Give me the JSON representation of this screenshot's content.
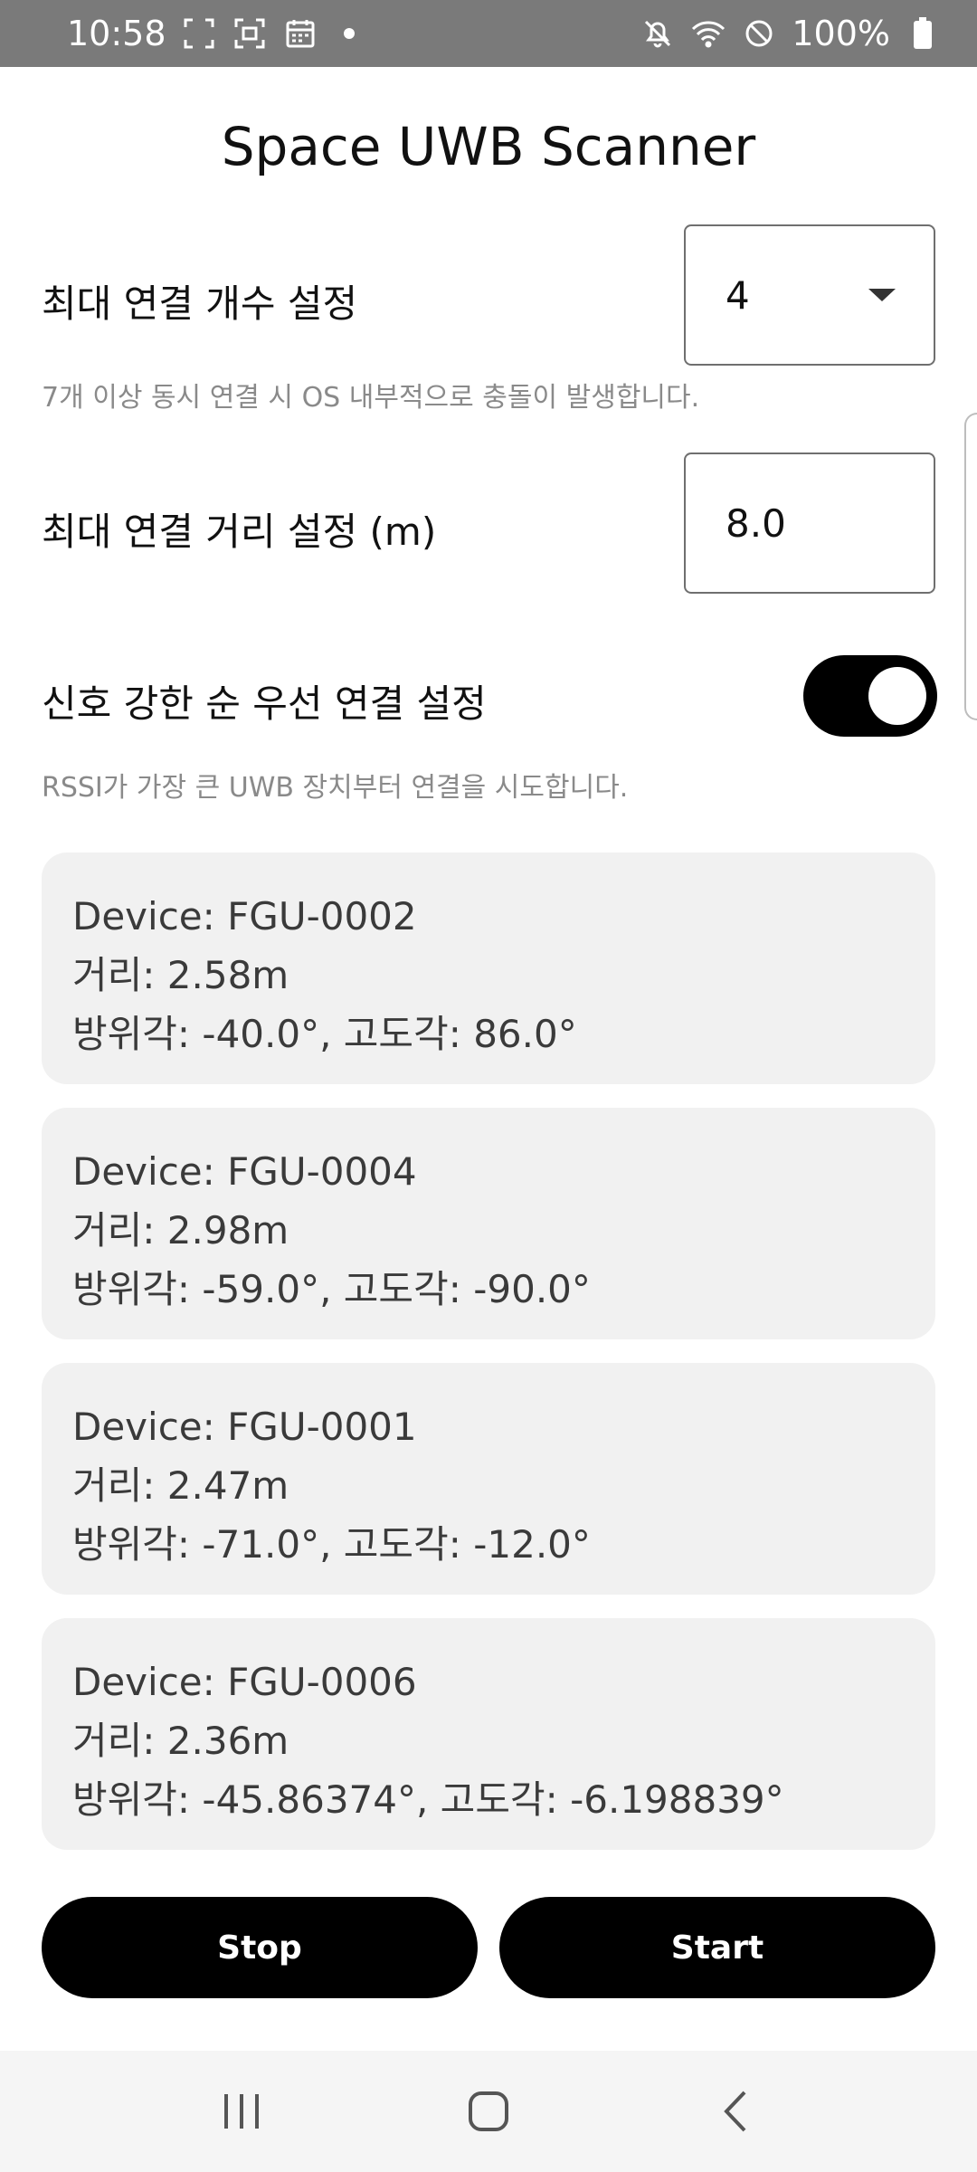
{
  "status_bar": {
    "time": "10:58",
    "battery": "100%",
    "icons": [
      "screenshot-icon",
      "scan-icon",
      "calendar-icon",
      "mute-icon",
      "wifi-icon",
      "dnd-icon",
      "battery-icon"
    ]
  },
  "app": {
    "title": "Space UWB Scanner"
  },
  "settings": {
    "max_connections": {
      "label": "최대 연결 개수 설정",
      "value": "4",
      "hint": "7개 이상 동시 연결 시 OS 내부적으로 충돌이 발생합니다."
    },
    "max_distance": {
      "label": "최대 연결 거리 설정 (m)",
      "value": "8.0"
    },
    "strong_signal_first": {
      "label": "신호 강한 순 우선 연결 설정",
      "enabled": true,
      "hint": "RSSI가 가장 큰 UWB 장치부터 연결을 시도합니다."
    }
  },
  "devices": [
    {
      "name": "Device: FGU-0002",
      "distance": "거리: 2.58m",
      "angles": "방위각: -40.0°, 고도각: 86.0°"
    },
    {
      "name": "Device: FGU-0004",
      "distance": "거리: 2.98m",
      "angles": "방위각: -59.0°, 고도각: -90.0°"
    },
    {
      "name": "Device: FGU-0001",
      "distance": "거리: 2.47m",
      "angles": "방위각: -71.0°, 고도각: -12.0°"
    },
    {
      "name": "Device: FGU-0006",
      "distance": "거리: 2.36m",
      "angles": "방위각: -45.86374°, 고도각: -6.198839°"
    }
  ],
  "actions": {
    "stop_label": "Stop",
    "start_label": "Start"
  },
  "colors": {
    "accent": "#000000",
    "card_bg": "#f1f1f1",
    "status_bar_bg": "#7a7a7a"
  }
}
